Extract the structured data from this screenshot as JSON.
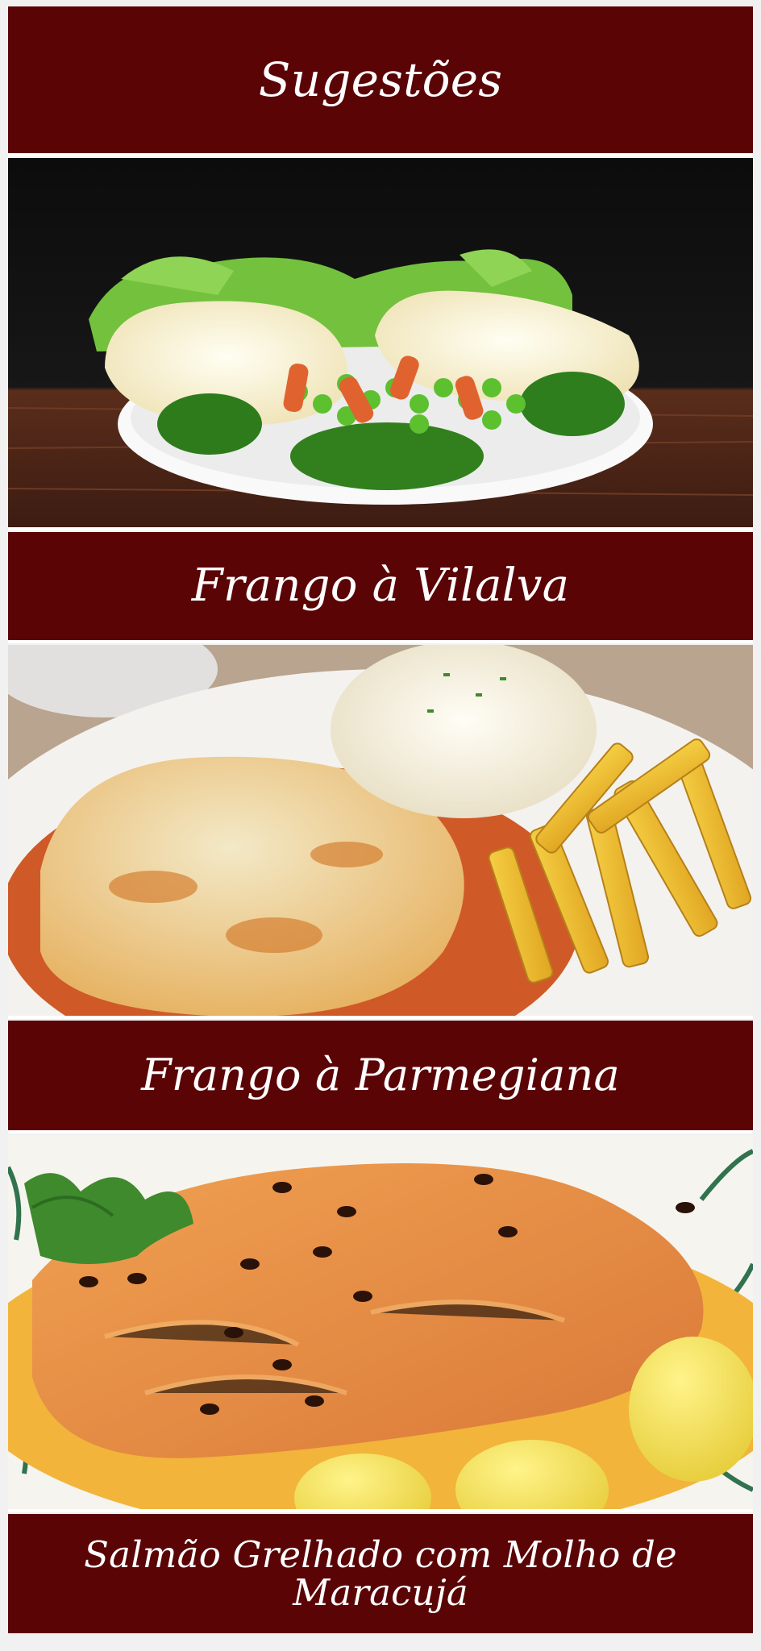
{
  "page_title": "Sugestões",
  "dishes": [
    {
      "name": "Frango à Vilalva"
    },
    {
      "name": "Frango à Parmegiana"
    },
    {
      "name": "Salmão Grelhado com Molho de Maracujá"
    }
  ],
  "theme": {
    "banner_color": "#5a0406",
    "text_color": "#ffffff",
    "background": "#f1f1f1"
  }
}
